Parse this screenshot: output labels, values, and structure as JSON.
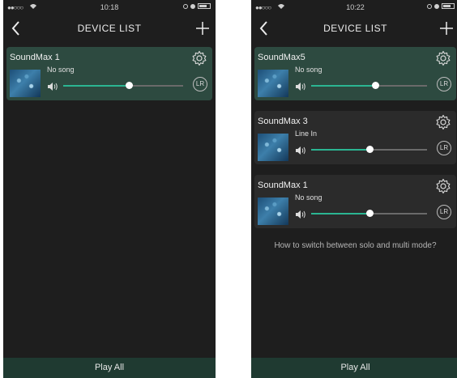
{
  "screens": [
    {
      "status": {
        "time": "10:18",
        "signal": "●●○○○"
      },
      "header": {
        "title": "DEVICE LIST"
      },
      "devices": [
        {
          "name": "SoundMax 1",
          "song": "No song",
          "volume": 0.55,
          "channel": "LR",
          "active": true
        }
      ],
      "help_text": "",
      "footer": {
        "play_all": "Play All"
      }
    },
    {
      "status": {
        "time": "10:22",
        "signal": "●●○○○"
      },
      "header": {
        "title": "DEVICE LIST"
      },
      "devices": [
        {
          "name": "SoundMax5",
          "song": "No song",
          "volume": 0.55,
          "channel": "LR",
          "active": true
        },
        {
          "name": "SoundMax 3",
          "song": "Line In",
          "volume": 0.5,
          "channel": "LR",
          "active": false
        },
        {
          "name": "SoundMax 1",
          "song": "No song",
          "volume": 0.5,
          "channel": "LR",
          "active": false
        }
      ],
      "help_text": "How to switch between solo and multi mode?",
      "footer": {
        "play_all": "Play All"
      }
    }
  ],
  "colors": {
    "background": "#1e1e1e",
    "card": "#2b2b2b",
    "card_active": "#2d4a40",
    "accent": "#2bb592",
    "footer": "#1f3a31"
  }
}
